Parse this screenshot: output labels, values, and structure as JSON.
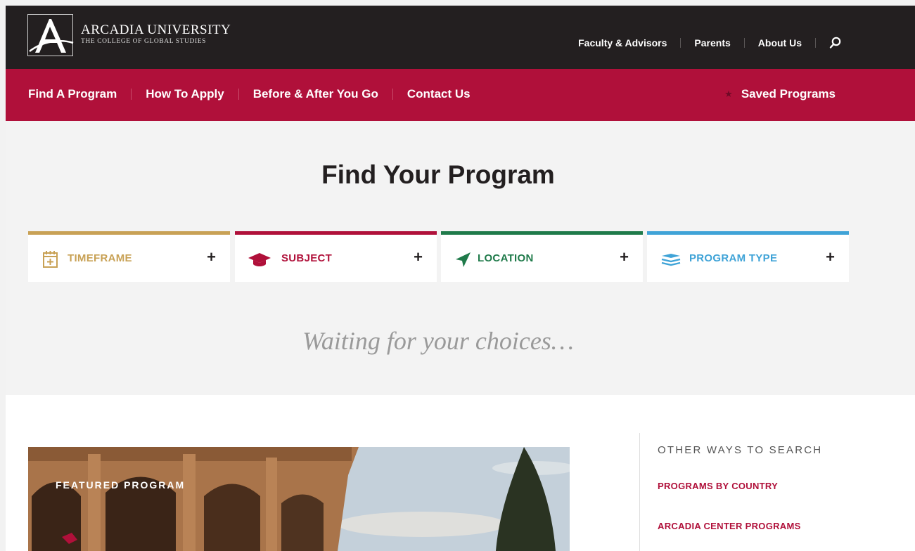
{
  "brand": {
    "name": "ARCADIA UNIVERSITY",
    "subtitle": "THE COLLEGE OF GLOBAL STUDIES"
  },
  "utility_nav": {
    "items": [
      {
        "label": "Faculty & Advisors"
      },
      {
        "label": "Parents"
      },
      {
        "label": "About Us"
      }
    ],
    "search_icon": "search-icon"
  },
  "main_nav": {
    "items": [
      {
        "label": "Find A Program"
      },
      {
        "label": "How To Apply"
      },
      {
        "label": "Before & After You Go"
      },
      {
        "label": "Contact Us"
      }
    ],
    "saved_label": "Saved Programs",
    "saved_icon": "star-icon"
  },
  "hero": {
    "title": "Find Your Program",
    "waiting_text": "Waiting for your choices…"
  },
  "filters": [
    {
      "label": "TIMEFRAME",
      "icon": "calendar-icon",
      "color": "#c8a155",
      "toggle": "+"
    },
    {
      "label": "SUBJECT",
      "icon": "graduation-cap-icon",
      "color": "#b0103a",
      "toggle": "+"
    },
    {
      "label": "LOCATION",
      "icon": "location-arrow-icon",
      "color": "#1f7a4a",
      "toggle": "+"
    },
    {
      "label": "PROGRAM TYPE",
      "icon": "layers-icon",
      "color": "#3fa3d7",
      "toggle": "+"
    }
  ],
  "featured": {
    "label": "FEATURED PROGRAM"
  },
  "sidebar": {
    "title": "OTHER WAYS TO SEARCH",
    "links": [
      {
        "label": "PROGRAMS BY COUNTRY"
      },
      {
        "label": "ARCADIA CENTER PROGRAMS"
      }
    ]
  },
  "colors": {
    "topbar": "#231f20",
    "main_nav": "#b0103a",
    "hero_bg": "#f3f3f3"
  }
}
